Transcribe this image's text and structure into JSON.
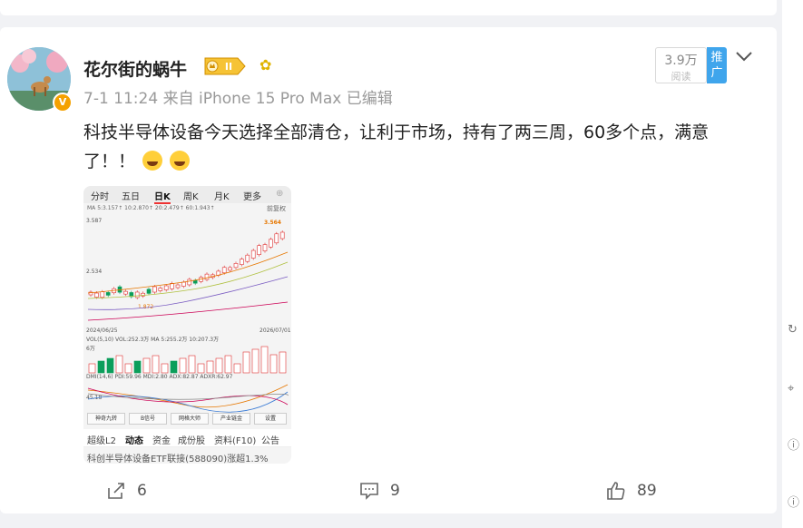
{
  "post": {
    "username": "花尔街的蜗牛",
    "vip_level": "II",
    "meta": "7-1 11:24 来自 iPhone 15 Pro Max 已编辑",
    "text": "科技半导体设备今天选择全部清仓，让利于市场，持有了两三周，60多个点，满意了！！",
    "views_count": "3.9万",
    "views_label": "阅读",
    "promote_label": "推广",
    "emoji_count": 2
  },
  "stock_screenshot": {
    "nav_tabs": [
      "分时",
      "五日",
      "日K",
      "周K",
      "月K",
      "更多"
    ],
    "active_nav": "日K",
    "ma_line": "MA  5:3.157↑  10:2.870↑  20:2.479↑  60:1.943↑",
    "adjust_label": "前复权",
    "y_high": "3.587",
    "y_mid": "2.534",
    "price_tag": "3.564",
    "low_price": "1.872",
    "date_start": "2024/06/25",
    "date_end": "2026/07/01",
    "vol_line": "VOL(5,10)  VOL:252.3万  MA  5:255.2万  10:207.3万",
    "vol_axis": "6万",
    "dmi_line": "DMI(14,6)  PDI:59.96  MDI:2.80  ADX:82.87  ADXR:62.97",
    "dmi_axis": "45.18",
    "tool_buttons": [
      "神奇九转",
      "B信号",
      "网格大师",
      "产业链金",
      "设置"
    ],
    "bottom_tabs": [
      "超级L2",
      "动态",
      "资金",
      "成份股",
      "资料(F10)",
      "公告"
    ],
    "active_bottom_tab": "动态",
    "cutoff_text": "科创半导体设备ETF联接(588090)涨超1.3%"
  },
  "actions": {
    "share_count": "6",
    "comment_count": "9",
    "like_count": "89"
  },
  "colors": {
    "accent_blue": "#3fa5ec",
    "candle_up": "#e03131",
    "candle_down": "#0b9e5b",
    "vip_gold": "#f4a100"
  }
}
